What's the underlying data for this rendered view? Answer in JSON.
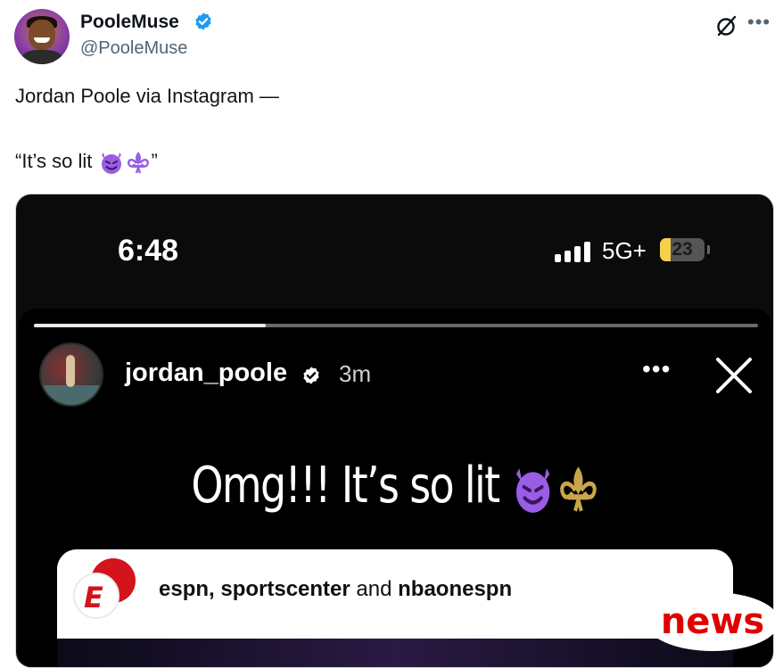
{
  "author": {
    "display_name": "PooleMuse",
    "handle": "@PooleMuse",
    "verified_icon": "verified-badge-icon"
  },
  "actions": {
    "grok_icon": "grok-icon",
    "more_label": "•••"
  },
  "tweet": {
    "line1": "Jordan Poole via Instagram —",
    "line2_text": "“It’s so lit ",
    "line2_emojis": "smiling-devil-emoji, fleur-de-lis-emoji",
    "line2_close": "”"
  },
  "media": {
    "status_bar": {
      "time": "6:48",
      "network": "5G+",
      "battery": "23",
      "battery_level": 0.23
    },
    "story": {
      "progress": 0.32,
      "username": "jordan_poole",
      "time_ago": "3m",
      "more_label": "•••",
      "caption": "Omg!!! It’s so lit ",
      "collab": {
        "part1": "espn, sportscenter",
        "part2": " and ",
        "part3": "nbaonespn"
      }
    }
  },
  "watermark": "news",
  "colors": {
    "verified_blue": "#1d9bf0",
    "handle_gray": "#536471",
    "espn_red": "#d4141c",
    "battery_yellow": "#f7d04a",
    "watermark_red": "#e00000"
  }
}
